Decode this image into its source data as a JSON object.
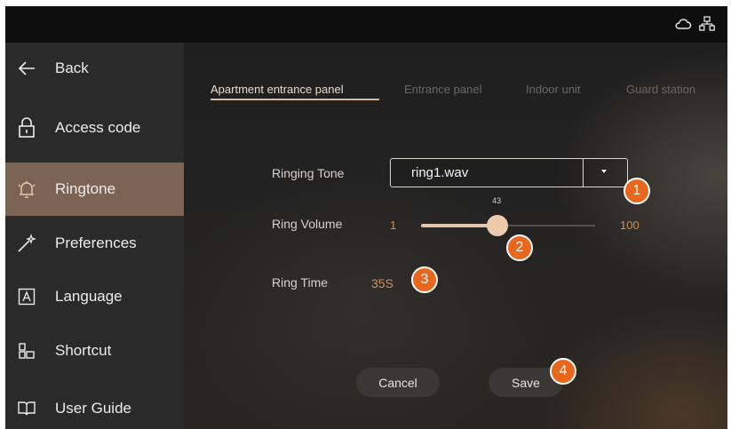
{
  "topbar": {
    "icons": [
      "cloud-icon",
      "network-icon"
    ]
  },
  "sidebar": {
    "items": [
      {
        "label": "Back",
        "icon": "back-arrow-icon",
        "active": false
      },
      {
        "label": "Access code",
        "icon": "lock-icon",
        "active": false
      },
      {
        "label": "Ringtone",
        "icon": "bell-icon",
        "active": true
      },
      {
        "label": "Preferences",
        "icon": "magic-wand-icon",
        "active": false
      },
      {
        "label": "Language",
        "icon": "language-icon",
        "active": false
      },
      {
        "label": "Shortcut",
        "icon": "shortcut-icon",
        "active": false
      },
      {
        "label": "User Guide",
        "icon": "book-icon",
        "active": false
      }
    ]
  },
  "tabs": [
    {
      "label": "Apartment entrance panel",
      "active": true
    },
    {
      "label": "Entrance panel",
      "active": false
    },
    {
      "label": "Indoor unit",
      "active": false
    },
    {
      "label": "Guard station",
      "active": false
    }
  ],
  "ringing_tone": {
    "label": "Ringing Tone",
    "value": "ring1.wav"
  },
  "ring_volume": {
    "label": "Ring Volume",
    "min": "1",
    "max": "100",
    "current": "43",
    "level": 43
  },
  "ring_time": {
    "label": "Ring Time",
    "value": "35S"
  },
  "actions": {
    "cancel_label": "Cancel",
    "save_label": "Save"
  },
  "callouts": [
    "1",
    "2",
    "3",
    "4"
  ],
  "colors": {
    "accent": "#e9661d",
    "active_sidebar": "#7c6455",
    "slider": "#edcbaa",
    "value_text": "#d29055"
  }
}
